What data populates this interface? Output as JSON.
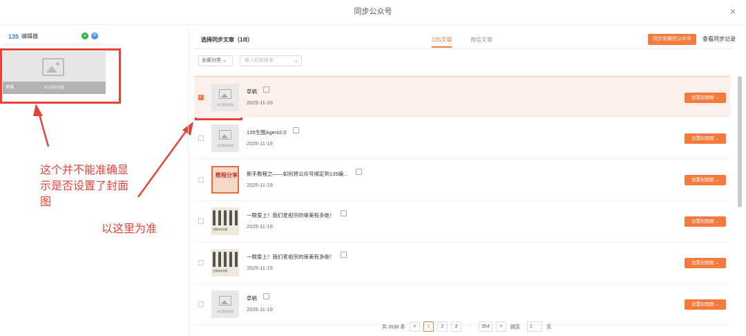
{
  "dialog": {
    "title": "同步公众号",
    "close_icon": "close-icon"
  },
  "sidebar": {
    "account_logo": "135",
    "account_name": "编辑器",
    "plus_label": "+",
    "sync_label": "⟳",
    "draft_caption": "草稿",
    "draft_placeholder": "未设置封面图"
  },
  "annotations": {
    "note_left": "这个并不能准确显示是否设置了封面图",
    "note_right": "以这里为准",
    "color": "#e8413a"
  },
  "main": {
    "title": "选择同步文章（1/8）",
    "tabs": [
      {
        "label": "135文章",
        "active": true
      },
      {
        "label": "微信文章",
        "active": false
      }
    ],
    "sync_button": "同步到微信公众号",
    "log_link": "查看同步记录",
    "category_select": "全部分类 ⌄",
    "search_placeholder": "输入标题搜索",
    "search_icon": "⌕",
    "accent": "#f57a3b"
  },
  "articles": [
    {
      "title": "草稿",
      "date": "2025-11-20",
      "thumb": "placeholder",
      "thumb_text": "未设置封面图",
      "checked": true,
      "cover_btn": "设置封面图 ⌄"
    },
    {
      "title": "135生图Agent2.0",
      "date": "2025-11-19",
      "thumb": "placeholder",
      "thumb_text": "未设置封面图",
      "checked": false,
      "cover_btn": "设置封面图 ⌄"
    },
    {
      "title": "新手教程之——如何将公众号绑定到135编…",
      "date": "2025-11-19",
      "thumb": "poster",
      "thumb_text": "教程分享",
      "checked": false,
      "cover_btn": "设置封面图 ⌄"
    },
    {
      "title": "一眼爱上！我们老祖宗的审美有多绝！",
      "date": "2025-11-19",
      "thumb": "photo",
      "thumb_text": "古韵流水中国",
      "checked": false,
      "cover_btn": "设置封面图 ⌄"
    },
    {
      "title": "一眼爱上！我们老祖宗的审美有多绝！",
      "date": "2025-11-19",
      "thumb": "photo",
      "thumb_text": "古韵流水中国",
      "checked": false,
      "cover_btn": "设置封面图 ⌄"
    },
    {
      "title": "草稿",
      "date": "2025-11-19",
      "thumb": "placeholder",
      "thumb_text": "未设置封面图",
      "checked": false,
      "cover_btn": "设置封面图 ⌄"
    }
  ],
  "pagination": {
    "total": "共 3538 条",
    "prev": "<",
    "pages": [
      "1",
      "2",
      "3"
    ],
    "ellipsis": "...",
    "last": "354",
    "next": ">",
    "jump_label": "跳至",
    "jump_value": "1",
    "page_unit": "页"
  }
}
